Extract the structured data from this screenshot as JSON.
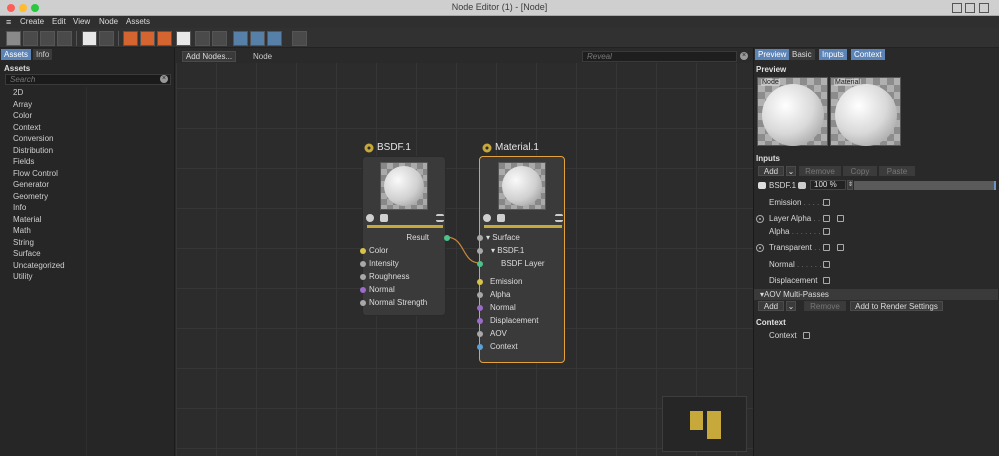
{
  "window": {
    "title": "Node Editor (1) - [Node]"
  },
  "menu": [
    "Create",
    "Edit",
    "View",
    "Node",
    "Assets"
  ],
  "left_panel": {
    "tabs": [
      "Assets",
      "Info"
    ],
    "heading": "Assets",
    "search_placeholder": "Search",
    "items": [
      "2D",
      "Array",
      "Color",
      "Context",
      "Conversion",
      "Distribution",
      "Fields",
      "Flow Control",
      "Generator",
      "Geometry",
      "Info",
      "Material",
      "Math",
      "String",
      "Surface",
      "Uncategorized",
      "Utility"
    ]
  },
  "canvas": {
    "add_nodes_label": "Add Nodes...",
    "tab_label": "Node",
    "reveal_placeholder": "Reveal",
    "nodes": {
      "bsdf": {
        "title": "BSDF.1",
        "output": "Result",
        "inputs": [
          "Color",
          "Intensity",
          "Roughness",
          "Normal",
          "Normal Strength"
        ],
        "port_colors": [
          "#d8c34a",
          "#a8a8a8",
          "#a8a8a8",
          "#9b6bc9",
          "#a8a8a8"
        ]
      },
      "material": {
        "title": "Material.1",
        "surface": "Surface",
        "bsdf_child": "BSDF.1",
        "bsdf_layer": "BSDF Layer",
        "inputs": [
          "Emission",
          "Alpha",
          "Normal",
          "Displacement",
          "AOV",
          "Context"
        ],
        "port_colors": [
          "#d8c34a",
          "#a8a8a8",
          "#9b6bc9",
          "#9b6bc9",
          "#a8a8a8",
          "#5aa0d6"
        ]
      }
    }
  },
  "right_panel": {
    "tabs": [
      "Preview",
      "Basic",
      "Inputs",
      "Context"
    ],
    "preview_heading": "Preview",
    "preview_labels": [
      "Node",
      "Material"
    ],
    "inputs_heading": "Inputs",
    "buttons": {
      "add": "Add",
      "remove": "Remove",
      "copy": "Copy",
      "paste": "Paste"
    },
    "bsdf_row": {
      "label": "BSDF.1",
      "value": "100 %"
    },
    "rows": {
      "emission": "Emission",
      "layer_alpha": "Layer Alpha",
      "alpha": "Alpha",
      "transparent": "Transparent",
      "normal": "Normal",
      "displacement": "Displacement"
    },
    "aov": {
      "heading": "AOV Multi-Passes",
      "add": "Add",
      "remove": "Remove",
      "render_settings": "Add to Render Settings"
    },
    "context_heading": "Context",
    "context_row": "Context"
  },
  "colors": {
    "accent": "#5c83b5",
    "selection": "#e5a23b",
    "node_bar": "#c6a93a"
  }
}
